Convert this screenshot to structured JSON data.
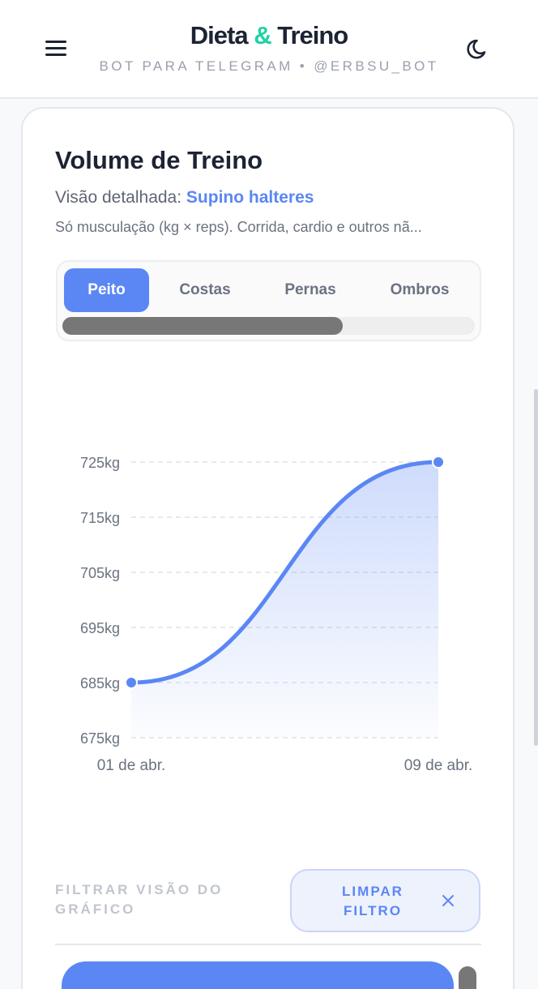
{
  "header": {
    "brand_part1": "Dieta",
    "brand_amp": "&",
    "brand_part2": "Treino",
    "subtitle": "BOT PARA TELEGRAM • @ERBSU_BOT",
    "menu_icon": "hamburger-menu-icon",
    "theme_icon": "moon-icon"
  },
  "card": {
    "title": "Volume de Treino",
    "subtitle_prefix": "Visão detalhada:",
    "exercise": "Supino halteres",
    "note": "Só musculação (kg × reps). Corrida, cardio e outros nã..."
  },
  "tabs": [
    {
      "label": "Peito",
      "active": true
    },
    {
      "label": "Costas",
      "active": false
    },
    {
      "label": "Pernas",
      "active": false
    },
    {
      "label": "Ombros",
      "active": false
    }
  ],
  "chart_data": {
    "type": "area",
    "x": [
      "01 de abr.",
      "09 de abr."
    ],
    "series": [
      {
        "values": [
          685,
          725
        ]
      }
    ],
    "y_ticks": [
      "725kg",
      "715kg",
      "705kg",
      "695kg",
      "685kg",
      "675kg"
    ],
    "ylim": [
      675,
      725
    ],
    "y_unit": "kg",
    "grid": true,
    "line_color": "#5b87f4"
  },
  "filter": {
    "label": "FILTRAR VISÃO DO GRÁFICO",
    "clear_label": "LIMPAR FILTRO",
    "clear_icon": "close-icon"
  },
  "colors": {
    "accent": "#5b87f4",
    "brand_amp": "#1dd3a5"
  }
}
